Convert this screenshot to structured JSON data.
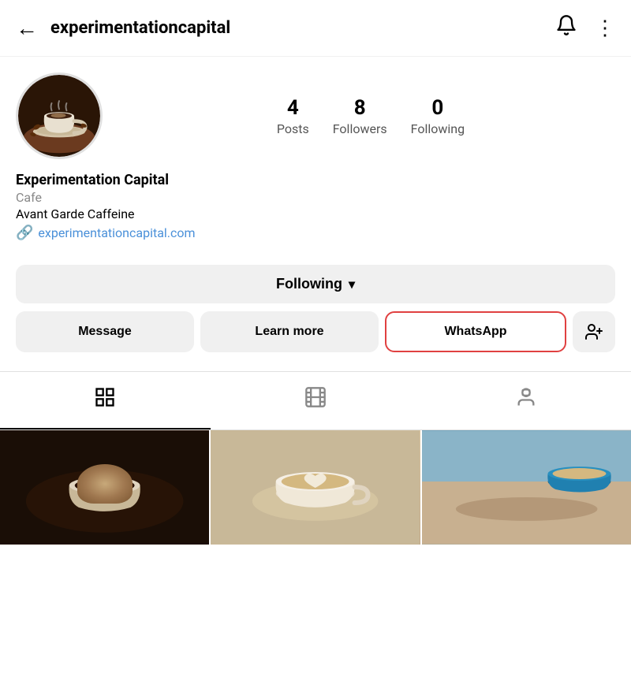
{
  "header": {
    "back_label": "←",
    "title": "experimentationcapital",
    "bell_icon": "🔔",
    "dots_icon": "⋮"
  },
  "profile": {
    "name": "Experimentation Capital",
    "category": "Cafe",
    "tagline": "Avant Garde Caffeine",
    "link_text": "experimentationcapital.com",
    "link_icon": "🔗"
  },
  "stats": [
    {
      "number": "4",
      "label": "Posts"
    },
    {
      "number": "8",
      "label": "Followers"
    },
    {
      "number": "0",
      "label": "Following"
    }
  ],
  "buttons": {
    "following_label": "Following",
    "chevron": "▾",
    "message_label": "Message",
    "learn_more_label": "Learn more",
    "whatsapp_label": "WhatsApp",
    "add_icon": "+👤"
  },
  "tabs": [
    {
      "name": "grid",
      "icon": "⊞",
      "active": true
    },
    {
      "name": "reels",
      "icon": "▶",
      "active": false
    },
    {
      "name": "tagged",
      "icon": "👤",
      "active": false
    }
  ]
}
